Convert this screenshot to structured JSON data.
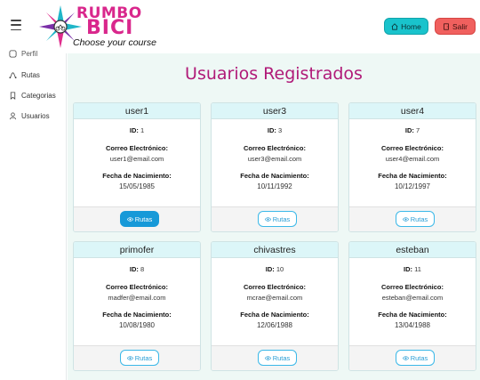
{
  "header": {
    "logo_line1": "RUMBO",
    "logo_line2": "BICI",
    "logo_tagline": "Choose your course",
    "home_label": "Home",
    "salir_label": "Salir"
  },
  "sidebar": {
    "items": [
      {
        "label": "Perfil",
        "icon": "user-circle-icon"
      },
      {
        "label": "Rutas",
        "icon": "route-icon"
      },
      {
        "label": "Categorias",
        "icon": "bookmark-icon"
      },
      {
        "label": "Usuarios",
        "icon": "user-icon"
      }
    ]
  },
  "main": {
    "title": "Usuarios Registrados",
    "id_label": "ID:",
    "email_label": "Correo Electrónico:",
    "birth_label": "Fecha de Nacimiento:",
    "rutas_label": "Rutas",
    "users": [
      {
        "name": "user1",
        "id": "1",
        "email": "user1@email.com",
        "birth": "15/05/1985"
      },
      {
        "name": "user3",
        "id": "3",
        "email": "user3@email.com",
        "birth": "10/11/1992"
      },
      {
        "name": "user4",
        "id": "7",
        "email": "user4@email.com",
        "birth": "10/12/1997"
      },
      {
        "name": "primofer",
        "id": "8",
        "email": "madfer@email.com",
        "birth": "10/08/1980"
      },
      {
        "name": "chivastres",
        "id": "10",
        "email": "mcrae@email.com",
        "birth": "12/06/1988"
      },
      {
        "name": "esteban",
        "id": "11",
        "email": "esteban@email.com",
        "birth": "13/04/1988"
      }
    ]
  },
  "colors": {
    "accent_pink": "#b01a78",
    "home_teal": "#19c3cc",
    "salir_red": "#f0605e",
    "rutas_blue": "#1799d8"
  }
}
